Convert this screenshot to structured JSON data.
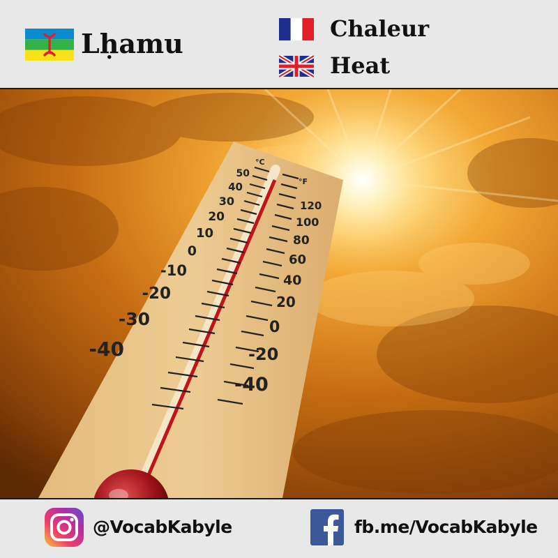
{
  "header": {
    "main_word": "Lḥamu",
    "translations": [
      {
        "lang": "French",
        "flag_icon": "france-flag-icon",
        "text": "Chaleur"
      },
      {
        "lang": "English",
        "flag_icon": "uk-flag-icon",
        "text": "Heat"
      }
    ],
    "main_flag_icon": "amazigh-flag-icon"
  },
  "thermometer": {
    "celsius_unit": "°C",
    "fahrenheit_unit": "°F",
    "celsius_labels": [
      "50",
      "40",
      "30",
      "20",
      "10",
      "0",
      "-10",
      "-20",
      "-30",
      "-40"
    ],
    "fahrenheit_labels": [
      "120",
      "100",
      "80",
      "60",
      "40",
      "20",
      "0",
      "-20",
      "-40"
    ]
  },
  "footer": {
    "instagram_handle": "@VocabKabyle",
    "facebook_link": "fb.me/VocabKabyle"
  },
  "colors": {
    "sky_orange": "#e08a1a",
    "sun_glow": "#fff6d0",
    "header_bg": "#e8e8e8"
  }
}
